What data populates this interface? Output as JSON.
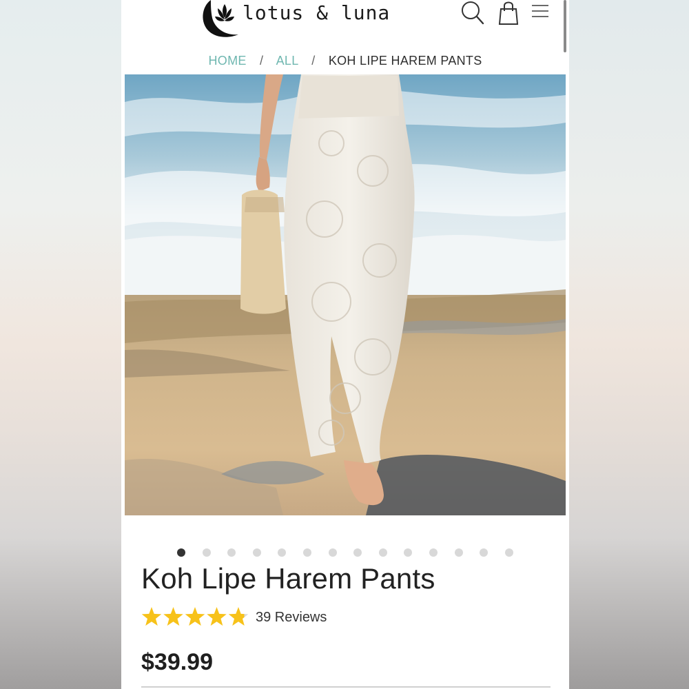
{
  "brand": {
    "name": "lotus & luna",
    "logo_icon": "lotus-moon-icon"
  },
  "header": {
    "icons": {
      "search": "search-icon",
      "cart": "shopping-bag-icon",
      "menu": "hamburger-menu-icon"
    }
  },
  "breadcrumb": {
    "items": [
      "HOME",
      "ALL",
      "KOH LIPE HAREM PANTS"
    ],
    "separator": "/"
  },
  "gallery": {
    "image_alt": "Model wearing white patterned harem pants walking barefoot on beach rocks holding a straw bag",
    "total_slides": 14,
    "active_index": 0
  },
  "product": {
    "title": "Koh Lipe Harem Pants",
    "rating": 4.8,
    "rating_max": 5,
    "reviews_label": "39 Reviews",
    "price": "$39.99"
  },
  "colors": {
    "accent_link": "#6fb7b0",
    "star": "#f7c21a",
    "dot_active": "#333333",
    "dot_inactive": "#d8d8d8"
  }
}
